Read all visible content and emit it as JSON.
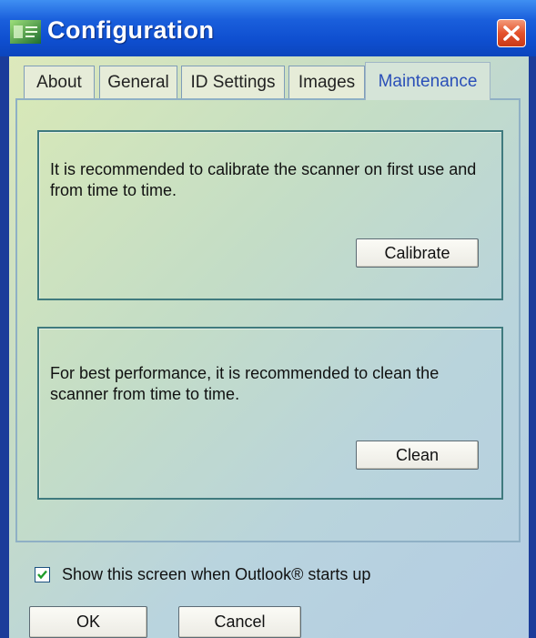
{
  "window": {
    "title": "Configuration"
  },
  "tabs": [
    {
      "label": "About",
      "active": false
    },
    {
      "label": "General",
      "active": false
    },
    {
      "label": "ID Settings",
      "active": false
    },
    {
      "label": "Images",
      "active": false
    },
    {
      "label": "Maintenance",
      "active": true
    }
  ],
  "calibrate_group": {
    "text": "It is recommended to calibrate the scanner on first use and from time to time.",
    "button_label": "Calibrate"
  },
  "clean_group": {
    "text": "For best performance, it is recommended to clean the scanner from time to time.",
    "button_label": "Clean"
  },
  "startup_checkbox": {
    "label": "Show this screen when Outlook® starts up",
    "checked": true
  },
  "footer": {
    "ok_label": "OK",
    "cancel_label": "Cancel"
  },
  "colors": {
    "titlebar": "#0f4fd0",
    "close": "#e4522c",
    "active_tab_text": "#2a4fb8"
  },
  "icons": {
    "app": "scanner-app-icon",
    "close": "close-icon",
    "check": "checkmark-icon"
  }
}
